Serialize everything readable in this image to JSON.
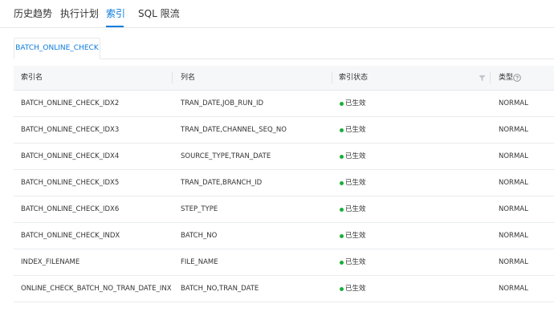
{
  "tabs": [
    {
      "label": "历史趋势",
      "active": false
    },
    {
      "label": "执行计划",
      "active": false
    },
    {
      "label": "索引",
      "active": true
    },
    {
      "label": "SQL 限流",
      "active": false
    }
  ],
  "table_tabs": [
    {
      "label": "BATCH_ONLINE_CHECK",
      "active": true
    }
  ],
  "columns": {
    "index_name": "索引名",
    "column_name": "列名",
    "index_status": "索引状态",
    "type": "类型"
  },
  "icons": {
    "filter": "filter-icon",
    "help": "question-circle-icon"
  },
  "colors": {
    "accent": "#0a7bdc",
    "status_active": "#1aaf3a",
    "header_bg": "#f6f7f9"
  },
  "rows": [
    {
      "index_name": "BATCH_ONLINE_CHECK_IDX2",
      "columns": "TRAN_DATE,JOB_RUN_ID",
      "status": "已生效",
      "type": "NORMAL"
    },
    {
      "index_name": "BATCH_ONLINE_CHECK_IDX3",
      "columns": "TRAN_DATE,CHANNEL_SEQ_NO",
      "status": "已生效",
      "type": "NORMAL"
    },
    {
      "index_name": "BATCH_ONLINE_CHECK_IDX4",
      "columns": "SOURCE_TYPE,TRAN_DATE",
      "status": "已生效",
      "type": "NORMAL"
    },
    {
      "index_name": "BATCH_ONLINE_CHECK_IDX5",
      "columns": "TRAN_DATE,BRANCH_ID",
      "status": "已生效",
      "type": "NORMAL"
    },
    {
      "index_name": "BATCH_ONLINE_CHECK_IDX6",
      "columns": "STEP_TYPE",
      "status": "已生效",
      "type": "NORMAL"
    },
    {
      "index_name": "BATCH_ONLINE_CHECK_INDX",
      "columns": "BATCH_NO",
      "status": "已生效",
      "type": "NORMAL"
    },
    {
      "index_name": "INDEX_FILENAME",
      "columns": "FILE_NAME",
      "status": "已生效",
      "type": "NORMAL"
    },
    {
      "index_name": "ONLINE_CHECK_BATCH_NO_TRAN_DATE_INX",
      "columns": "BATCH_NO,TRAN_DATE",
      "status": "已生效",
      "type": "NORMAL"
    }
  ]
}
